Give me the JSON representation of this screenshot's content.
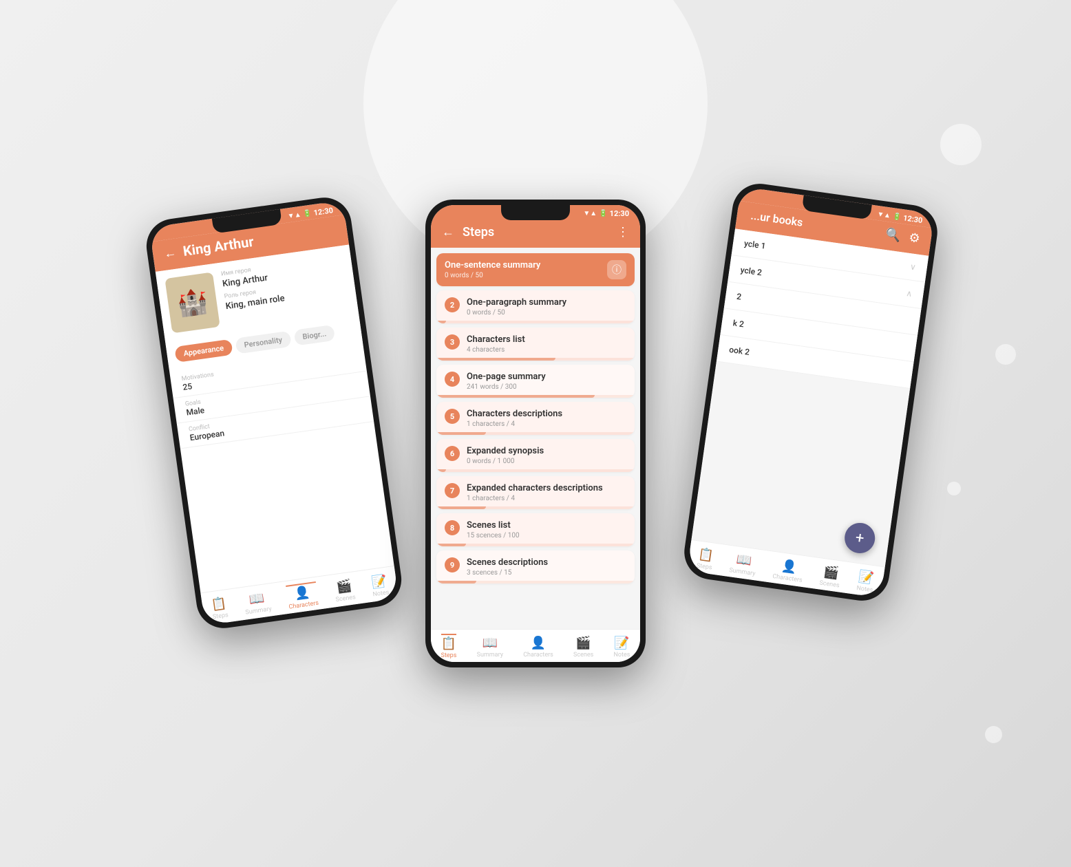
{
  "background": {
    "color": "#ebebeb"
  },
  "phone_left": {
    "header": {
      "back_icon": "←",
      "title": "King Arthur",
      "status_time": "12:30"
    },
    "character": {
      "name_label": "Имя героя",
      "name_value": "King Arthur",
      "role_label": "Роль героя",
      "role_value": "King, main role"
    },
    "tabs": [
      "Appearance",
      "Personality",
      "Biogr..."
    ],
    "fields": [
      {
        "label": "Motivations",
        "value": "25"
      },
      {
        "label": "Goals",
        "value": "Male"
      },
      {
        "label": "Conflict",
        "value": "European"
      }
    ],
    "bottom_nav": [
      {
        "icon": "📋",
        "label": "Steps"
      },
      {
        "icon": "📖",
        "label": "Summary"
      },
      {
        "icon": "👤",
        "label": "Characters",
        "active": true
      },
      {
        "icon": "🎬",
        "label": "Scenes"
      },
      {
        "icon": "📝",
        "label": "Notes"
      }
    ]
  },
  "phone_center": {
    "header": {
      "back_icon": "←",
      "title": "Steps",
      "menu_icon": "⋮",
      "status_time": "12:30"
    },
    "steps": [
      {
        "number": "",
        "title": "One-sentence summary",
        "sub": "0 words / 50",
        "progress": 0,
        "first": true
      },
      {
        "number": "2",
        "title": "One-paragraph summary",
        "sub": "0 words / 50",
        "progress": 5
      },
      {
        "number": "3",
        "title": "Characters list",
        "sub": "4 characters",
        "progress": 60
      },
      {
        "number": "4",
        "title": "One-page summary",
        "sub": "241 words / 300",
        "progress": 80
      },
      {
        "number": "5",
        "title": "Characters descriptions",
        "sub": "1 characters / 4",
        "progress": 25
      },
      {
        "number": "6",
        "title": "Expanded synopsis",
        "sub": "0 words / 1 000",
        "progress": 5
      },
      {
        "number": "7",
        "title": "Expanded characters descriptions",
        "sub": "1 characters / 4",
        "progress": 25
      },
      {
        "number": "8",
        "title": "Scenes list",
        "sub": "15 scences / 100",
        "progress": 15
      },
      {
        "number": "9",
        "title": "Scenes descriptions",
        "sub": "3 scences / 15",
        "progress": 20
      }
    ],
    "bottom_nav": [
      {
        "icon": "📋",
        "label": "Steps",
        "active": true
      },
      {
        "icon": "📖",
        "label": "Summary"
      },
      {
        "icon": "👤",
        "label": "Characters"
      },
      {
        "icon": "🎬",
        "label": "Scenes"
      },
      {
        "icon": "📝",
        "label": "Notes"
      }
    ]
  },
  "phone_right": {
    "header": {
      "search_icon": "🔍",
      "settings_icon": "⚙",
      "status_time": "12:30",
      "title": "...ur books"
    },
    "books": [
      {
        "name": "ycle 1",
        "chevron": "∨"
      },
      {
        "name": "ycle 2",
        "chevron": "∧"
      },
      {
        "name": "2",
        "chevron": ""
      },
      {
        "name": "k 2",
        "chevron": ""
      },
      {
        "name": "ook 2",
        "chevron": ""
      }
    ],
    "fab": "+",
    "bottom_nav": [
      {
        "icon": "📋",
        "label": "Steps"
      },
      {
        "icon": "📖",
        "label": "Summary"
      },
      {
        "icon": "👤",
        "label": "Characters"
      },
      {
        "icon": "🎬",
        "label": "Scenes"
      },
      {
        "icon": "📝",
        "label": "Notes"
      }
    ]
  }
}
